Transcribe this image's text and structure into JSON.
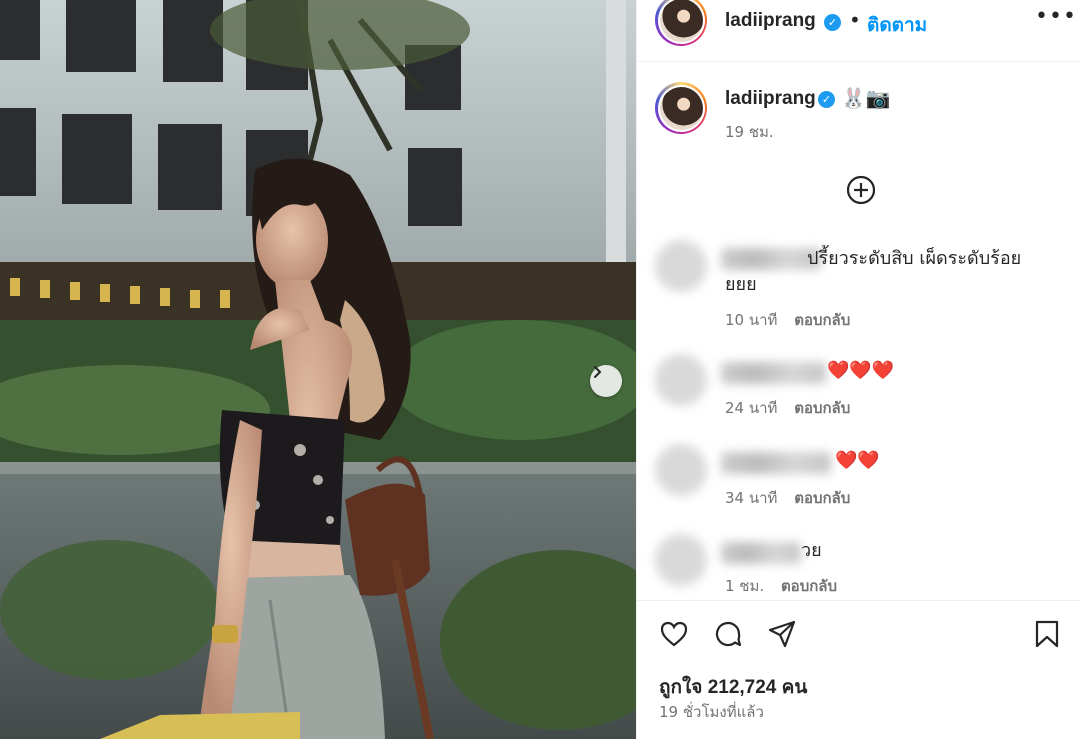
{
  "header": {
    "username": "ladiiprang",
    "separator": "•",
    "follow_label": "ติดตาม",
    "more_label": "•••"
  },
  "caption": {
    "username": "ladiiprang",
    "emoji": "🐰📷",
    "time": "19 ชม."
  },
  "comments": [
    {
      "text_line1": "ปรี้ยวระดับสิบ เผ็ดระดับร้อย",
      "text_line2": "ยยย",
      "time": "10 นาที",
      "reply": "ตอบกลับ"
    },
    {
      "text": "❤️❤️❤️",
      "time": "24 นาที",
      "reply": "ตอบกลับ"
    },
    {
      "text": "❤️❤️",
      "time": "34 นาที",
      "reply": "ตอบกลับ"
    },
    {
      "text": "วย",
      "time": "1 ชม.",
      "reply": "ตอบกลับ"
    }
  ],
  "footer": {
    "likes": "ถูกใจ 212,724 คน",
    "posted": "19 ชั่วโมงที่แล้ว"
  },
  "icons": {
    "verified": "verified-badge-icon",
    "load_more": "plus-circle-icon",
    "next": "chevron-right-icon",
    "comment": "comment-icon",
    "share": "share-icon",
    "save": "bookmark-icon"
  },
  "colors": {
    "link_blue": "#0095f6",
    "verified_blue": "#1d9bf0",
    "meta_gray": "#737373",
    "heart_red": "#e8222e"
  }
}
